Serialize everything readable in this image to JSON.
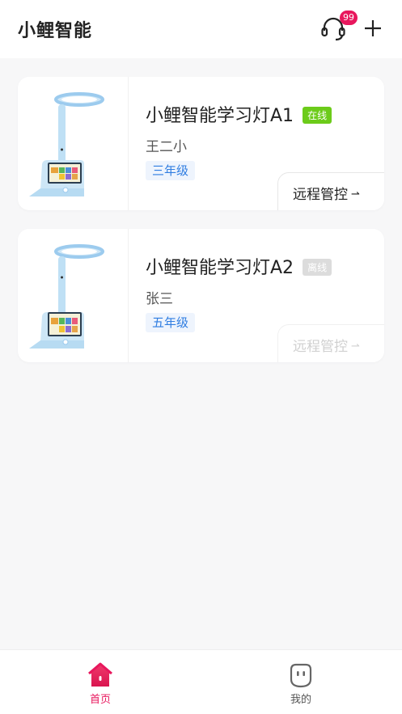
{
  "header": {
    "title": "小鲤智能",
    "badge_count": "99",
    "support_icon": "headset-icon",
    "add_icon": "plus-icon"
  },
  "devices": [
    {
      "name": "小鲤智能学习灯A1",
      "status": "在线",
      "owner": "王二小",
      "grade": "三年级",
      "action": "远程管控",
      "action_arrow": "⇀"
    },
    {
      "name": "小鲤智能学习灯A2",
      "status": "离线",
      "owner": "张三",
      "grade": "五年级",
      "action": "远程管控",
      "action_arrow": "⇀"
    }
  ],
  "tabbar": {
    "home": "首页",
    "mine": "我的"
  },
  "colors": {
    "accent": "#e8175d",
    "online": "#6ccb1a",
    "offline": "#dcdcdc",
    "grade_text": "#2f7de1"
  }
}
